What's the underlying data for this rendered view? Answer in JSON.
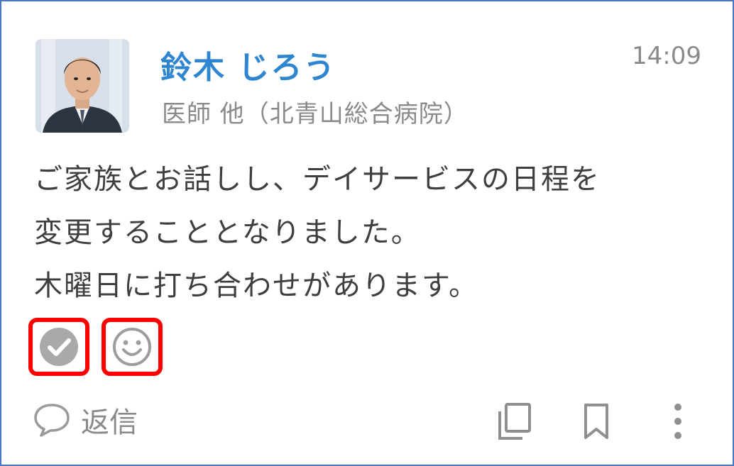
{
  "post": {
    "author_name": "鈴木 じろう",
    "author_role": "医師 他（北青山総合病院）",
    "time": "14:09",
    "message_lines": [
      "ご家族とお話しし、デイサービスの日程を",
      "変更することとなりました。",
      "木曜日に打ち合わせがあります。"
    ]
  },
  "reactions": {
    "icons": [
      "check-circle-icon",
      "smiley-icon"
    ],
    "highlight_color": "#ff0000"
  },
  "actions": {
    "reply_label": "返信",
    "icons": [
      "comment-icon",
      "copy-icon",
      "bookmark-icon",
      "more-vertical-icon"
    ]
  },
  "colors": {
    "name": "#2f86d0",
    "muted": "#8a8a8a",
    "text": "#3f3f3f",
    "frame": "#4a77c2"
  }
}
